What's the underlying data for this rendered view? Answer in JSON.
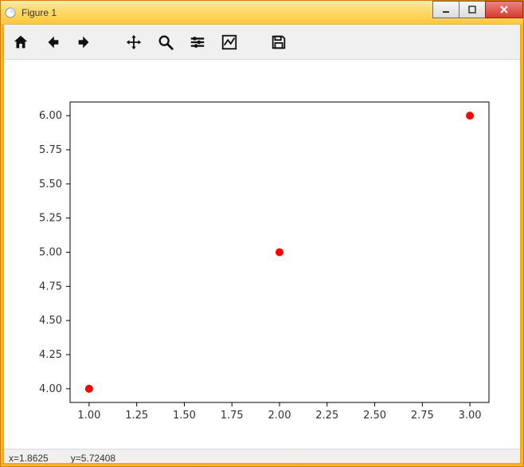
{
  "window": {
    "title": "Figure 1"
  },
  "toolbar": {
    "home": "home-icon",
    "back": "back-icon",
    "forward": "forward-icon",
    "pan": "pan-icon",
    "zoom": "zoom-icon",
    "subplots": "subplots-icon",
    "edit": "edit-icon",
    "save": "save-icon"
  },
  "status": {
    "x_label": "x=1.8625",
    "y_label": "y=5.72408"
  },
  "chart_data": {
    "type": "scatter",
    "x": [
      1,
      2,
      3
    ],
    "y": [
      4,
      5,
      6
    ],
    "marker_color": "#ff0000",
    "marker_radius": 5,
    "xlim": [
      0.9,
      3.1
    ],
    "ylim": [
      3.9,
      6.1
    ],
    "xticks": [
      1.0,
      1.25,
      1.5,
      1.75,
      2.0,
      2.25,
      2.5,
      2.75,
      3.0
    ],
    "yticks": [
      4.0,
      4.25,
      4.5,
      4.75,
      5.0,
      5.25,
      5.5,
      5.75,
      6.0
    ],
    "title": "",
    "xlabel": "",
    "ylabel": ""
  }
}
